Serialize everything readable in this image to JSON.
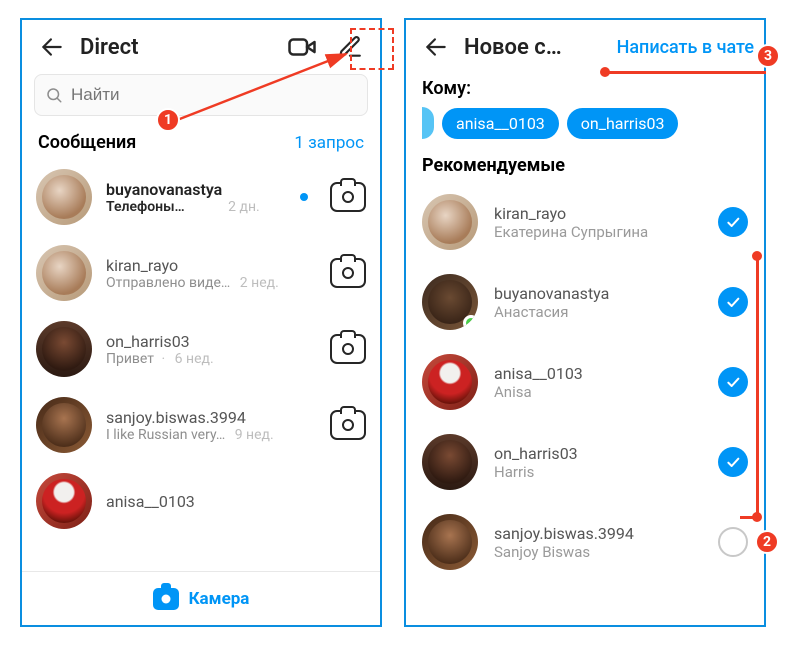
{
  "annotations": {
    "step1": "1",
    "step2": "2",
    "step3": "3"
  },
  "left": {
    "title": "Direct",
    "search_placeholder": "Найти",
    "section_title": "Сообщения",
    "requests_link": "1 запрос",
    "camera_label": "Камера",
    "chats": [
      {
        "name": "buyanovanastya",
        "sub": "Телефоны…",
        "time": "2 дн.",
        "unread": true
      },
      {
        "name": "kiran_rayo",
        "sub": "Отправлено виде…",
        "time": "2 нед."
      },
      {
        "name": "on_harris03",
        "sub": "Привет",
        "time": "6 нед."
      },
      {
        "name": "sanjoy.biswas.3994",
        "sub": "I like Russian very…",
        "time": "9 нед."
      },
      {
        "name": "anisa__0103",
        "sub": "",
        "time": ""
      }
    ]
  },
  "right": {
    "title": "Новое с…",
    "action": "Написать в чате",
    "to_label": "Кому:",
    "chips": [
      "anisa__0103",
      "on_harris03"
    ],
    "recommended_title": "Рекомендуемые",
    "items": [
      {
        "name": "kiran_rayo",
        "sub": "Екатерина Супрыгина",
        "checked": true
      },
      {
        "name": "buyanovanastya",
        "sub": "Анастасия",
        "checked": true,
        "online": true
      },
      {
        "name": "anisa__0103",
        "sub": "Anisa",
        "checked": true
      },
      {
        "name": "on_harris03",
        "sub": "Harris",
        "checked": true
      },
      {
        "name": "sanjoy.biswas.3994",
        "sub": "Sanjoy Biswas",
        "checked": false
      }
    ]
  }
}
